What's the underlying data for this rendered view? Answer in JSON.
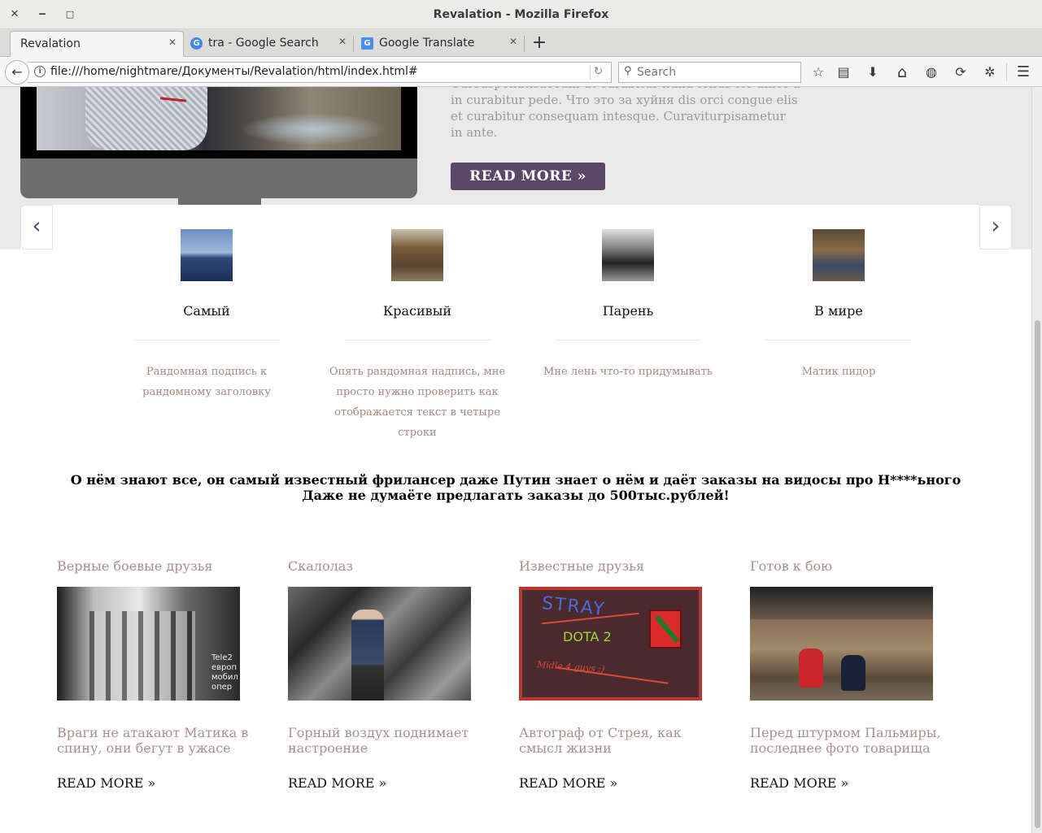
{
  "window": {
    "title": "Revalation - Mozilla Firefox",
    "close_glyph": "✕",
    "minimize_glyph": "‒",
    "maximize_glyph": "□"
  },
  "tabs": [
    {
      "label": "Revalation",
      "active": true,
      "icon": "none"
    },
    {
      "label": "tra - Google Search",
      "active": false,
      "icon": "google-icon",
      "icon_glyph": "G",
      "icon_color": "#4285f4"
    },
    {
      "label": "Google Translate",
      "active": false,
      "icon": "translate-icon",
      "icon_glyph": "G",
      "icon_color": "#4c8bf5"
    }
  ],
  "tab_close_glyph": "✕",
  "new_tab_glyph": "+",
  "navbar": {
    "back_glyph": "←",
    "url": "file:///home/nightmare/Документы/Revalation/html/index.html#",
    "info_glyph": "i",
    "reload_glyph": "↻",
    "search_glyph": "⚲",
    "search_placeholder": "Search",
    "toolbar_glyphs": {
      "bookmark": "☆",
      "reading_list": "▤",
      "download": "⬇",
      "home": "⌂",
      "web": "◍",
      "sync": "⟳",
      "extension": "✲",
      "menu": "☰"
    }
  },
  "hero": {
    "text": "Cursuspenatisaccum ut curabitur nulla tellus tor ames a in curabitur pede. Что это за хуйня dis orci congue elis et curabitur consequam intesque. Curaviturpisametur in ante.",
    "button_label": "READ MORE »"
  },
  "slider": {
    "prev_glyph": "‹",
    "next_glyph": "›"
  },
  "features": [
    {
      "title": "Самый",
      "description": "Рандомная подпись к рандомному заголовку"
    },
    {
      "title": "Красивый",
      "description": "Опять рандомная надпись, мне просто нужно проверить как отображается текст в четыре строки"
    },
    {
      "title": "Парень",
      "description": "Мне лень что-то придумывать"
    },
    {
      "title": "В мире",
      "description": "Матик пидор"
    }
  ],
  "announcement": {
    "line1": "О нём знают все, он самый известный фрилансер даже Путин знает о нём и даёт заказы на видосы про Н****ьного",
    "line2": "Даже не думаёте предлагать заказы до 500тыс.рублей!"
  },
  "posts": [
    {
      "title": "Верные боевые друзья",
      "description": "Враги не атакают Матика в спину, они бегут в ужасе",
      "more": "READ MORE »",
      "image_overlay_text": "Tele2 европ мобил опер"
    },
    {
      "title": "Скалолаз",
      "description": "Горный воздух поднимает настроение",
      "more": "READ MORE »"
    },
    {
      "title": "Известные друзья",
      "description": "Автограф от Стрея, как смысл жизни",
      "more": "READ MORE »",
      "image_text_1": "STRAY",
      "image_text_2": "DOTA 2",
      "image_text_3": "Midle 4 guys :)"
    },
    {
      "title": "Готов к бою",
      "description": "Перед штурмом Пальмиры, последнее фото товарища",
      "more": "READ MORE »"
    }
  ]
}
